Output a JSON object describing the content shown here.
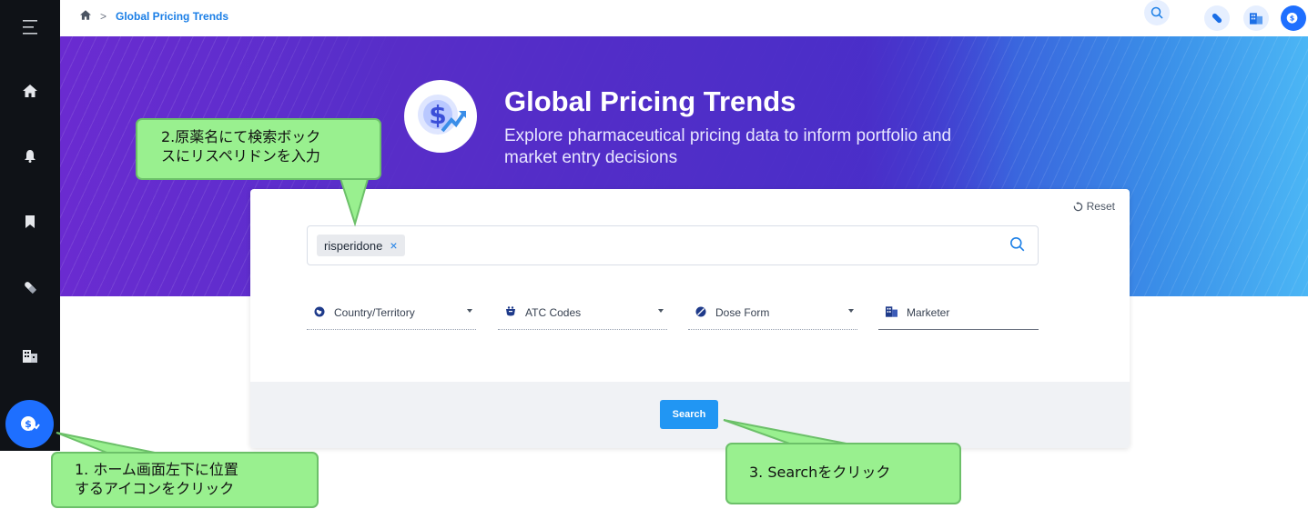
{
  "breadcrumb": {
    "current": "Global Pricing Trends",
    "separator": ">"
  },
  "hero": {
    "title": "Global Pricing Trends",
    "subtitle": "Explore pharmaceutical pricing data to inform portfolio and market entry decisions"
  },
  "search": {
    "chip_label": "risperidone",
    "chip_remove": "×",
    "reset_label": "Reset",
    "button_label": "Search"
  },
  "filters": [
    {
      "label": "Country/Territory",
      "icon": "globe-icon"
    },
    {
      "label": "ATC Codes",
      "icon": "atc-icon"
    },
    {
      "label": "Dose Form",
      "icon": "pill-icon"
    },
    {
      "label": "Marketer",
      "icon": "building-icon"
    }
  ],
  "sidebar": {
    "items": [
      {
        "icon": "menu-icon"
      },
      {
        "icon": "home-icon"
      },
      {
        "icon": "bell-icon"
      },
      {
        "icon": "bookmark-icon"
      },
      {
        "icon": "pill-icon"
      },
      {
        "icon": "building-icon"
      },
      {
        "icon": "pricing-trends-icon"
      }
    ]
  },
  "callouts": {
    "step1": {
      "line1": "1. ホーム画面左下に位置",
      "line2": "するアイコンをクリック"
    },
    "step2": {
      "line1": "2.原薬名にて検索ボック",
      "line2": "スにリスペリドンを入力"
    },
    "step3": {
      "line1": "3. Searchをクリック"
    }
  },
  "colors": {
    "accent": "#2196f3",
    "sidebar_bg": "#0f1217",
    "callout_bg": "#99f08f"
  }
}
